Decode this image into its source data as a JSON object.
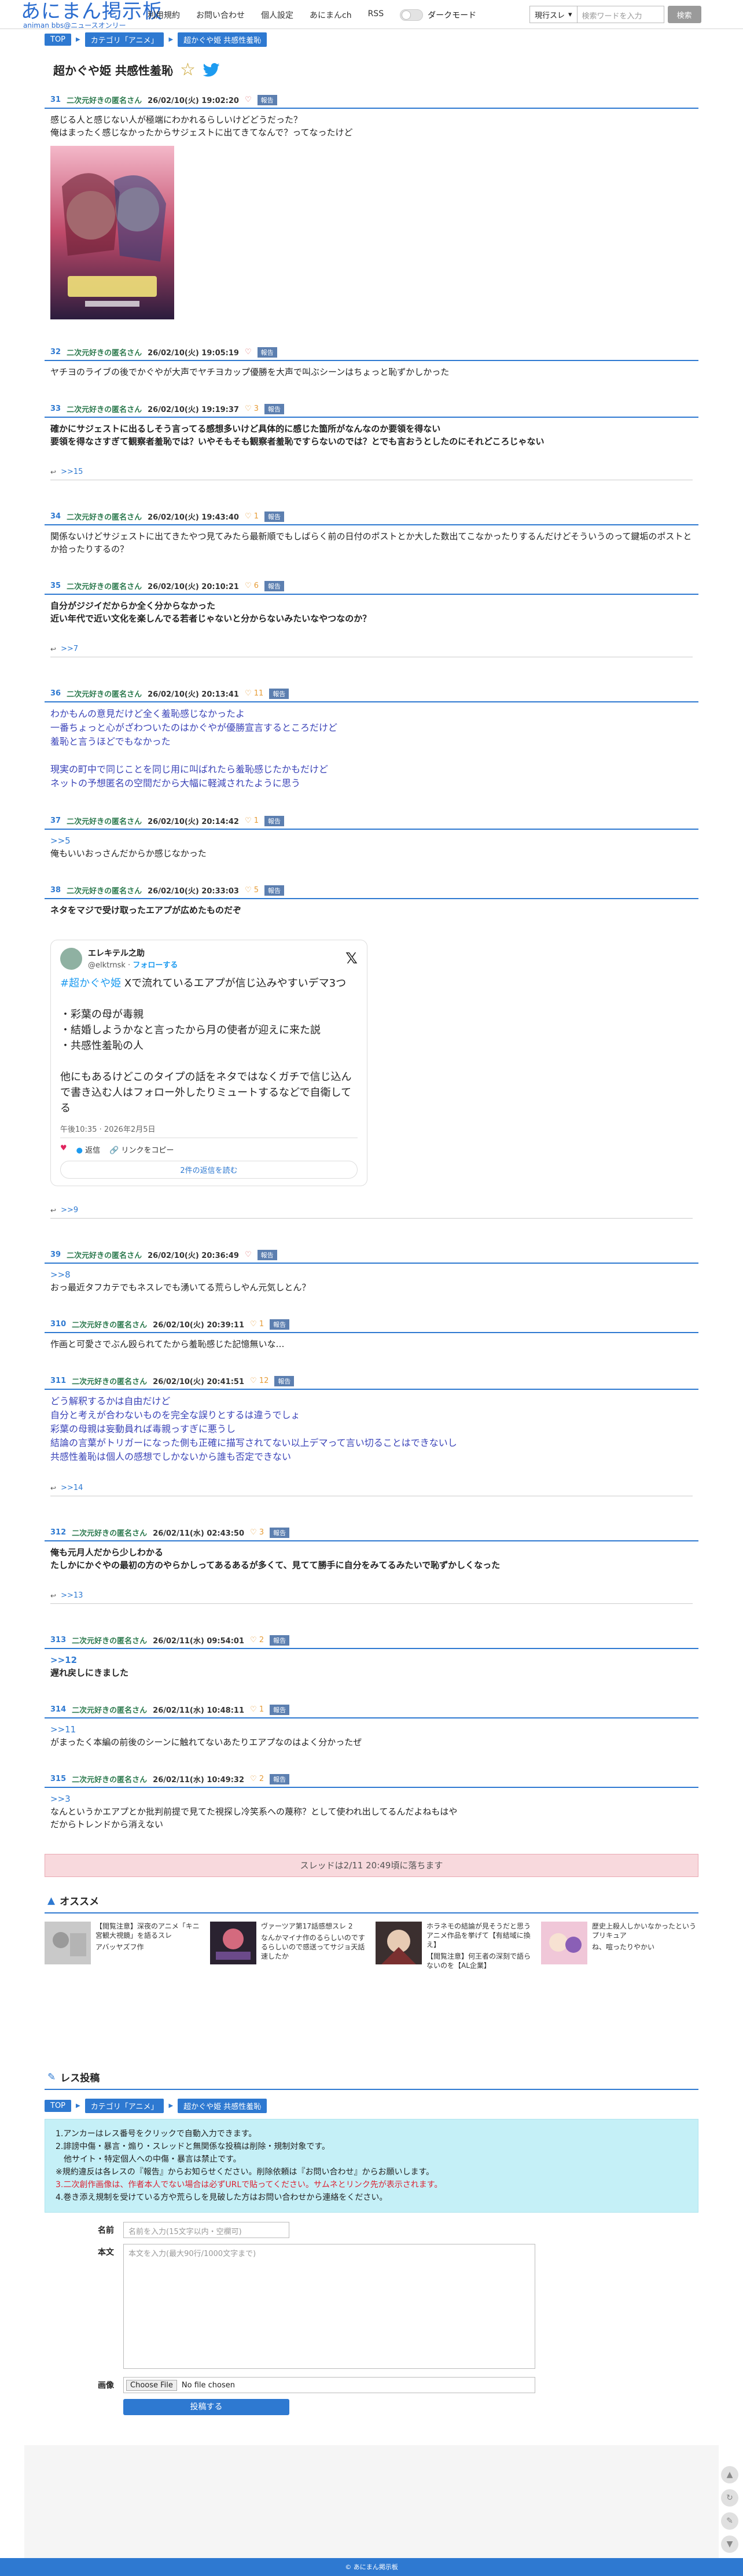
{
  "header": {
    "logo": "あにまん掲示板",
    "logo_sub": "animan bbs@ニュースオンリー",
    "nav": [
      "利用規約",
      "お問い合わせ",
      "個人設定",
      "あにまんch",
      "RSS"
    ],
    "dark_mode_label": "ダークモード",
    "search_select": "現行スレ",
    "search_placeholder": "検索ワードを入力",
    "search_button": "検索"
  },
  "breadcrumb": [
    "TOP",
    "カテゴリ「アニメ」",
    "超かぐや姫 共感性羞恥"
  ],
  "thread_title": "超かぐや姫 共感性羞恥",
  "poster_name": "二次元好きの匿名さん",
  "report_label": "報告",
  "posts": [
    {
      "num": "31",
      "date": "26/02/10(火) 19:02:20",
      "likes": "",
      "lines": [
        "感じる人と感じない人が極端にわかれるらしいけどどうだった？",
        "俺はまったく感じなかったからサジェストに出てきてなんで？ってなったけど"
      ]
    },
    {
      "num": "32",
      "date": "26/02/10(火) 19:05:19",
      "likes": "",
      "lines": [
        "ヤチヨのライブの後でかぐやが大声でヤチヨカップ優勝を大声で叫ぶシーンはちょっと恥ずかしかった"
      ]
    },
    {
      "num": "33",
      "date": "26/02/10(火) 19:19:37",
      "likes": "3",
      "lines": [
        "確かにサジェストに出るしそう言ってる感想多いけど具体的に感じた箇所がなんなのか要領を得ない",
        "要領を得なさすぎて観察者羞恥では？いやそもそも観察者羞恥ですらないのでは？とでも言おうとしたのにそれどころじゃない"
      ],
      "reply": ">>15"
    },
    {
      "num": "34",
      "date": "26/02/10(火) 19:43:40",
      "likes": "1",
      "lines": [
        "関係ないけどサジェストに出てきたやつ見てみたら最新順でもしばらく前の日付のポストとか大した数出てこなかったりするんだけどそういうのって鍵垢のポストとか拾ったりするの？"
      ]
    },
    {
      "num": "35",
      "date": "26/02/10(火) 20:10:21",
      "likes": "6",
      "lines": [
        "自分がジジイだからか全く分からなかった",
        "近い年代で近い文化を楽しんでる若者じゃないと分からないみたいなやつなのか？"
      ],
      "reply": ">>7"
    },
    {
      "num": "36",
      "date": "26/02/10(火) 20:13:41",
      "likes": "11",
      "lines": [
        "わかもんの意見だけど全く羞恥感じなかったよ",
        "一番ちょっと心がざわついたのはかぐやが優勝宣言するところだけど",
        "羞恥と言うほどでもなかった",
        "",
        "現実の町中で同じことを同じ用に叫ばれたら羞恥感じたかもだけど",
        "ネットの予想匿名の空間だから大幅に軽減されたように思う"
      ]
    },
    {
      "num": "37",
      "date": "26/02/10(火) 20:14:42",
      "likes": "1",
      "anchor": ">>5",
      "lines": [
        "俺もいいおっさんだからか感じなかった"
      ]
    },
    {
      "num": "38",
      "date": "26/02/10(火) 20:33:03",
      "likes": "5",
      "lines": [
        "ネタをマジで受け取ったエアプが広めたものだぞ"
      ],
      "reply": ">>9"
    },
    {
      "num": "39",
      "date": "26/02/10(火) 20:36:49",
      "likes": "",
      "anchor": ">>8",
      "lines": [
        "おっ最近タフカテでもネスレでも湧いてる荒らしやん元気しとん？"
      ]
    },
    {
      "num": "310",
      "date": "26/02/10(火) 20:39:11",
      "likes": "1",
      "lines": [
        "作画と可愛さでぶん殴られてたから羞恥感じた記憶無いな…"
      ]
    },
    {
      "num": "311",
      "date": "26/02/10(火) 20:41:51",
      "likes": "12",
      "lines": [
        "どう解釈するかは自由だけど",
        "自分と考えが合わないものを完全な誤りとするは違うでしょ",
        "彩葉の母親は妄動員れば毒親っすぎに悪うし",
        "結論の言葉がトリガーになった側も正確に描写されてない以上デマって言い切ることはできないし",
        "共感性羞恥は個人の感想でしかないから誰も否定できない"
      ],
      "reply": ">>14"
    },
    {
      "num": "312",
      "date": "26/02/11(水) 02:43:50",
      "likes": "3",
      "lines": [
        "俺も元月人だから少しわかる",
        "たしかにかぐやの最初の方のやらかしってあるあるが多くて、見てて勝手に自分をみてるみたいで恥ずかしくなった"
      ],
      "reply": ">>13"
    },
    {
      "num": "313",
      "date": "26/02/11(水) 09:54:01",
      "likes": "2",
      "anchor": ">>12",
      "lines": [
        "遅れ戻しにきました"
      ]
    },
    {
      "num": "314",
      "date": "26/02/11(水) 10:48:11",
      "likes": "1",
      "anchor": ">>11",
      "lines": [
        "がまったく本編の前後のシーンに触れてないあたりエアプなのはよく分かったぜ"
      ]
    },
    {
      "num": "315",
      "date": "26/02/11(水) 10:49:32",
      "likes": "2",
      "anchor": ">>3",
      "lines": [
        "なんというかエアプとか批判前提で見てた視探し冷笑系への蔑称？として使われ出してるんだよねもはや",
        "だからトレンドから消えない"
      ]
    }
  ],
  "tweet": {
    "name": "エレキテル之助",
    "handle": "@elktrnsk",
    "follow": "フォローする",
    "hashtag": "#超かぐや姫",
    "body_lines": [
      "Xで流れているエアプが信じ込みやすいデマ3つ",
      "",
      "・彩葉の母が毒親",
      "・結婚しようかなと言ったから月の使者が迎えに来た説",
      "・共感性羞恥の人",
      "",
      "他にもあるけどこのタイプの話をネタではなくガチで信じ込んで書き込む人はフォロー外したりミュートするなどで自衛してる"
    ],
    "time": "午後10:35 · 2026年2月5日",
    "reply": "返信",
    "copy": "リンクをコピー",
    "more": "2件の返信を読む"
  },
  "thread_end": "スレッドは2/11 20:49頃に落ちます",
  "recommend": {
    "title": "オススメ",
    "items": [
      "【閲覧注意】深夜のアニメ「キニ宮観大視鏡」を語るスレ",
      "ヴァーツア第17話感想スレ 2",
      "ホラネモの結論が見そうだと思うアニメ作品を挙げて【有結域に換え】",
      "歴史上殺人しかいなかったというプリキュア"
    ],
    "subs": [
      "アバッヤズフ作",
      "なんかマイナ作のるらしいのでするらしいので感送ってサジョ天話速したか",
      "【閲覧注意】何王者の深刻で語らないのを【AL企業】",
      "ね、喧ったりやかい"
    ]
  },
  "reply_form": {
    "title": "レス投稿",
    "notes": [
      "1.アンカーはレス番号をクリックで自動入力できます。",
      "2.誹謗中傷・暴言・煽り・スレッドと無関係な投稿は削除・規制対象です。",
      "　他サイト・特定個人への中傷・暴言は禁止です。",
      "※規約違反は各レスの『報告』からお知らせください。削除依頼は『お問い合わせ』からお願いします。",
      "3.二次創作画像は、作者本人でない場合は必ずURLで貼ってください。サムネとリンク先が表示されます。",
      "4.巻き添え規制を受けている方や荒らしを見破した方はお問い合わせから連絡をください。"
    ],
    "name_label": "名前",
    "name_placeholder": "名前を入力(15文字以内・空欄可)",
    "body_label": "本文",
    "body_placeholder": "本文を入力(最大90行/1000文字まで)",
    "image_label": "画像",
    "file_button": "Choose File",
    "file_status": "No file chosen",
    "submit": "投稿する"
  },
  "footer": "© あにまん掲示板"
}
